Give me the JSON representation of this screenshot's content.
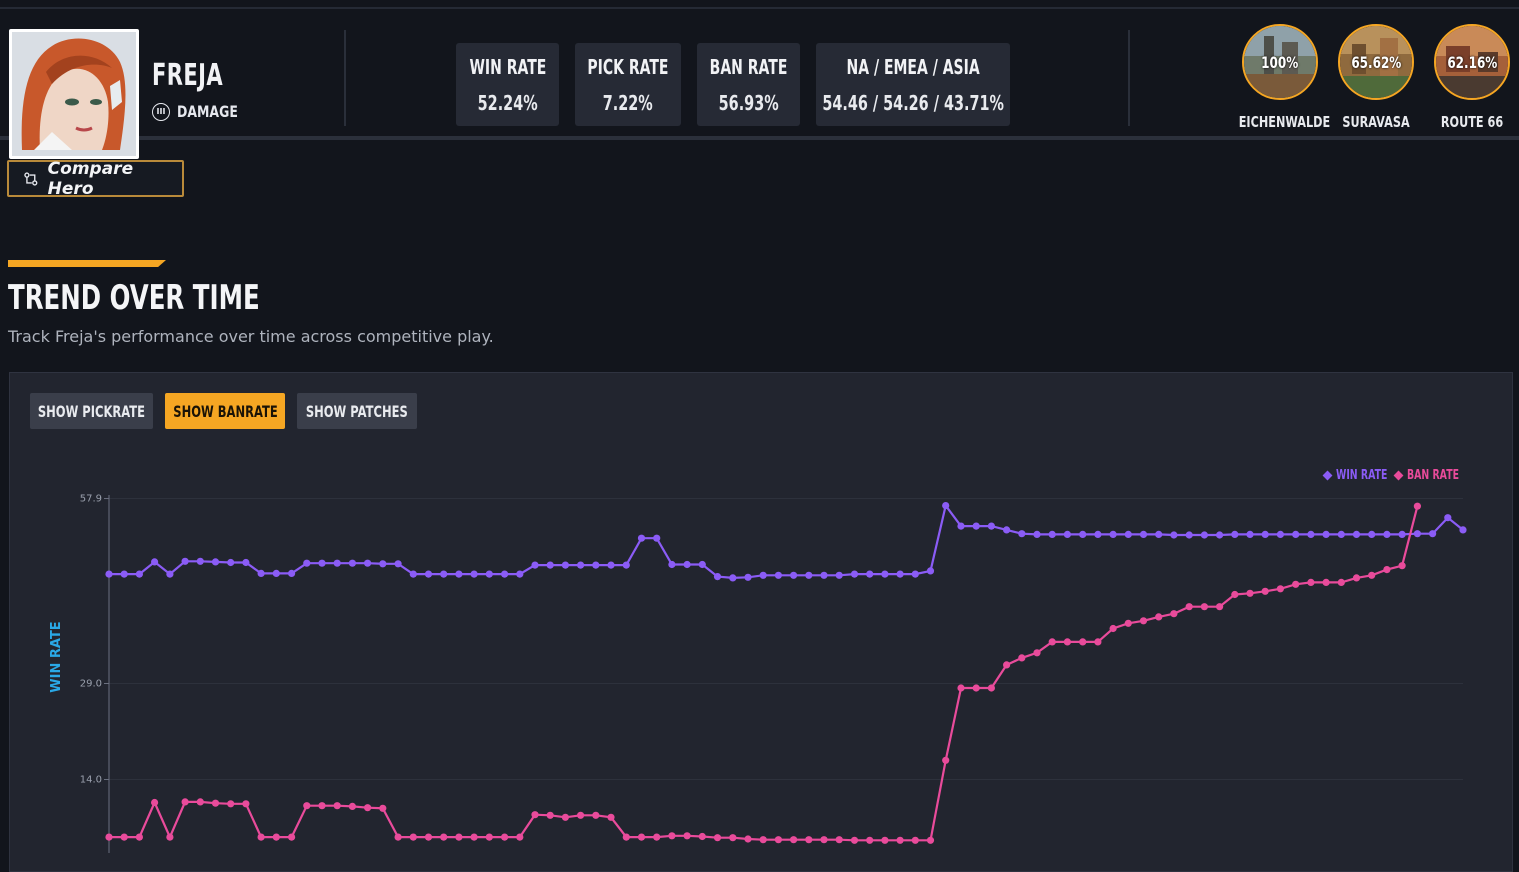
{
  "hero": {
    "name": "FREJA",
    "role": "DAMAGE",
    "compare_label": "Compare Hero"
  },
  "stats": [
    {
      "label": "WIN RATE",
      "value": "52.24%"
    },
    {
      "label": "PICK RATE",
      "value": "7.22%"
    },
    {
      "label": "BAN RATE",
      "value": "56.93%"
    },
    {
      "label": "NA / EMEA / ASIA",
      "value": "54.46 / 54.26 / 43.71%"
    }
  ],
  "maps": [
    {
      "name": "EICHENWALDE",
      "rate": "100%"
    },
    {
      "name": "SURAVASA",
      "rate": "65.62%"
    },
    {
      "name": "ROUTE 66",
      "rate": "62.16%"
    }
  ],
  "section": {
    "title": "TREND OVER TIME",
    "subtitle": "Track Freja's performance over time across competitive play."
  },
  "toggles": {
    "pickrate": "SHOW PICKRATE",
    "banrate": "SHOW BANRATE",
    "patches": "SHOW PATCHES"
  },
  "colors": {
    "accent": "#f5a623",
    "winrate": "#8b5cf6",
    "banrate": "#e94b9b",
    "axis_label": "#2aa8e6"
  },
  "chart_data": {
    "type": "line",
    "ylabel": "WIN RATE",
    "yticks": [
      57.9,
      29.0,
      14.0
    ],
    "series": [
      {
        "name": "WIN RATE",
        "values": [
          46.1,
          46.1,
          46.1,
          48.0,
          46.1,
          48.1,
          48.1,
          48.0,
          47.9,
          47.9,
          46.2,
          46.2,
          46.2,
          47.8,
          47.8,
          47.8,
          47.8,
          47.8,
          47.7,
          47.7,
          46.1,
          46.1,
          46.1,
          46.1,
          46.1,
          46.1,
          46.1,
          46.1,
          47.5,
          47.5,
          47.5,
          47.5,
          47.5,
          47.5,
          47.5,
          51.7,
          51.7,
          47.6,
          47.6,
          47.6,
          45.7,
          45.5,
          45.6,
          45.9,
          45.9,
          45.9,
          45.9,
          45.9,
          45.9,
          46.1,
          46.1,
          46.1,
          46.1,
          46.1,
          46.6,
          56.8,
          53.6,
          53.6,
          53.6,
          53.0,
          52.4,
          52.3,
          52.3,
          52.3,
          52.3,
          52.3,
          52.3,
          52.3,
          52.3,
          52.3,
          52.2,
          52.2,
          52.2,
          52.2,
          52.3,
          52.3,
          52.3,
          52.3,
          52.3,
          52.3,
          52.3,
          52.3,
          52.3,
          52.3,
          52.3,
          52.3,
          52.4,
          52.4,
          54.9,
          53.0
        ]
      },
      {
        "name": "BAN RATE",
        "values": [
          5.0,
          5.0,
          5.0,
          10.4,
          5.0,
          10.5,
          10.5,
          10.3,
          10.2,
          10.2,
          5.0,
          5.0,
          5.0,
          9.9,
          9.9,
          9.9,
          9.8,
          9.6,
          9.5,
          5.0,
          5.0,
          5.0,
          5.0,
          5.0,
          5.0,
          5.0,
          5.0,
          5.0,
          8.5,
          8.4,
          8.1,
          8.4,
          8.4,
          8.1,
          5.0,
          5.0,
          5.0,
          5.2,
          5.2,
          5.1,
          4.9,
          4.9,
          4.7,
          4.6,
          4.6,
          4.6,
          4.6,
          4.6,
          4.6,
          4.5,
          4.5,
          4.5,
          4.5,
          4.5,
          4.5,
          17.0,
          28.3,
          28.3,
          28.3,
          31.9,
          33.0,
          33.8,
          35.5,
          35.5,
          35.5,
          35.5,
          37.6,
          38.4,
          38.8,
          39.4,
          39.9,
          41.0,
          41.0,
          41.0,
          42.9,
          43.1,
          43.4,
          43.8,
          44.5,
          44.8,
          44.8,
          44.8,
          45.5,
          45.9,
          46.8,
          47.4,
          56.7
        ]
      }
    ]
  }
}
